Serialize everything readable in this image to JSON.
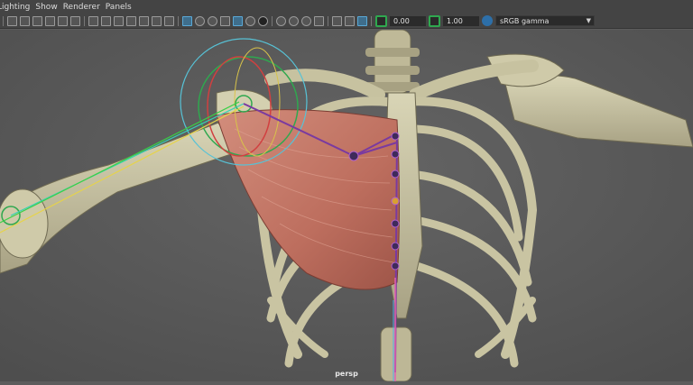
{
  "menu": {
    "items": [
      "Lighting",
      "Show",
      "Renderer",
      "Panels"
    ]
  },
  "toolbar": {
    "exposure_value": "0.00",
    "gamma_value": "1.00",
    "color_space": "sRGB gamma"
  },
  "viewport": {
    "camera": "persp"
  },
  "colors": {
    "background": "#5c5c5c",
    "bone": "#c9c4a2",
    "muscle": "#c47a68",
    "joint": "#7a3aa0",
    "accent_green": "#2fa84f"
  }
}
